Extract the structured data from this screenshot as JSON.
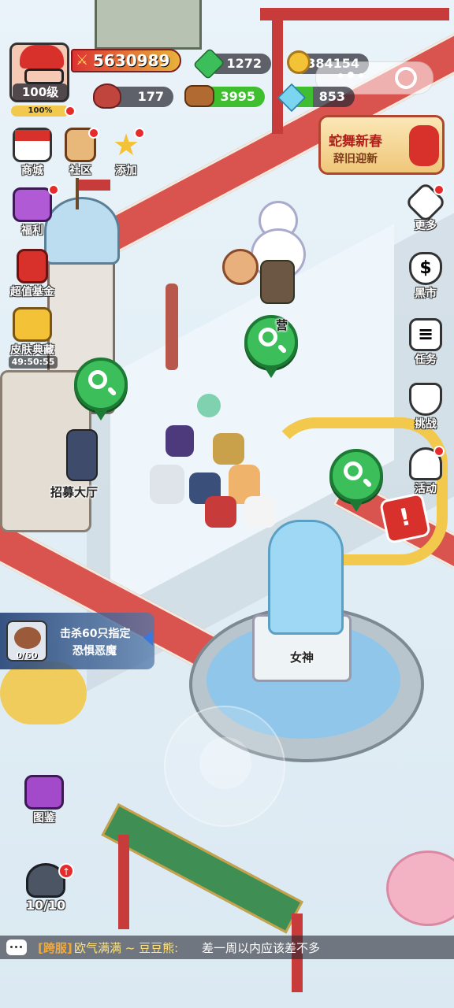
{
  "player": {
    "level": "100级",
    "exp_percent": "100%",
    "power": "5630989"
  },
  "resources": {
    "gems": "1272",
    "gold": "384154",
    "meat": "177",
    "wood": "3995",
    "crystal": "853"
  },
  "event_banner": {
    "title": "蛇舞新春",
    "subtitle": "辞旧迎新"
  },
  "left_menu": [
    {
      "label": "商城",
      "icon": "shop-icon"
    },
    {
      "label": "社区",
      "icon": "house-icon"
    },
    {
      "label": "添加",
      "icon": "star-icon"
    },
    {
      "label": "福利",
      "icon": "gift-icon"
    },
    {
      "label": "超值基金",
      "icon": "fund-icon"
    },
    {
      "label": "皮肤典藏",
      "icon": "chest-icon",
      "timer": "49:50:55"
    }
  ],
  "right_menu": [
    {
      "label": "更多",
      "icon": "grid-icon"
    },
    {
      "label": "黑市",
      "icon": "money-bag-icon"
    },
    {
      "label": "任务",
      "icon": "task-list-icon"
    },
    {
      "label": "挑战",
      "icon": "shield-icon"
    },
    {
      "label": "活动",
      "icon": "bell-icon"
    }
  ],
  "map_labels": {
    "camp": "营",
    "recruit_hall": "招募大厅",
    "goddess": "女神"
  },
  "quest": {
    "text_line1": "击杀60只指定",
    "text_line2": "恐惧恶魔",
    "progress": "0/60"
  },
  "bottom_left": {
    "codex_label": "图鉴",
    "heroes_count": "10/10"
  },
  "chat": {
    "channel": "[跨服]",
    "sender": "欧气满满 ~ 豆豆熊:",
    "message": "差一周以内应该差不多"
  },
  "colors": {
    "road": "#d9534f",
    "zoom_green": "#3cbf5a",
    "notify_red": "#e52b2b"
  }
}
